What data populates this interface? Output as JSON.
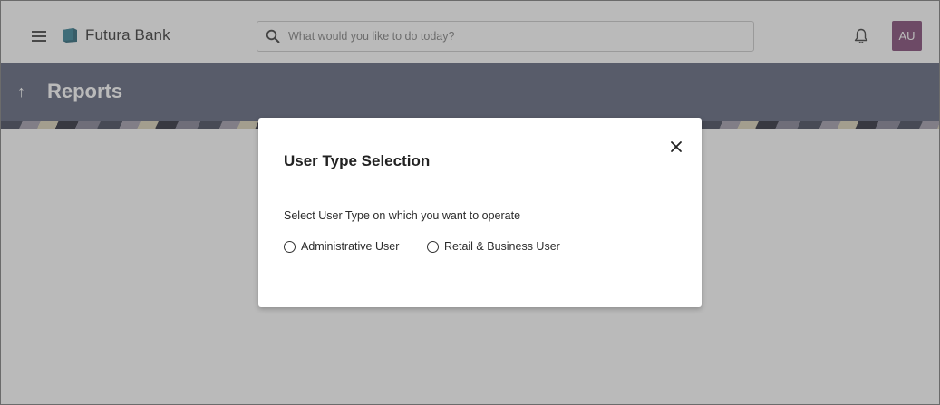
{
  "header": {
    "brand_name": "Futura Bank",
    "search_placeholder": "What would you like to do today?",
    "avatar_initials": "AU",
    "avatar_color": "#7b3f6f"
  },
  "banner": {
    "title": "Reports",
    "back_arrow": "↑",
    "background_color": "#565d76"
  },
  "modal": {
    "title": "User Type Selection",
    "description": "Select User Type on which you want to operate",
    "options": [
      {
        "label": "Administrative User",
        "selected": false
      },
      {
        "label": "Retail & Business User",
        "selected": false
      }
    ]
  }
}
